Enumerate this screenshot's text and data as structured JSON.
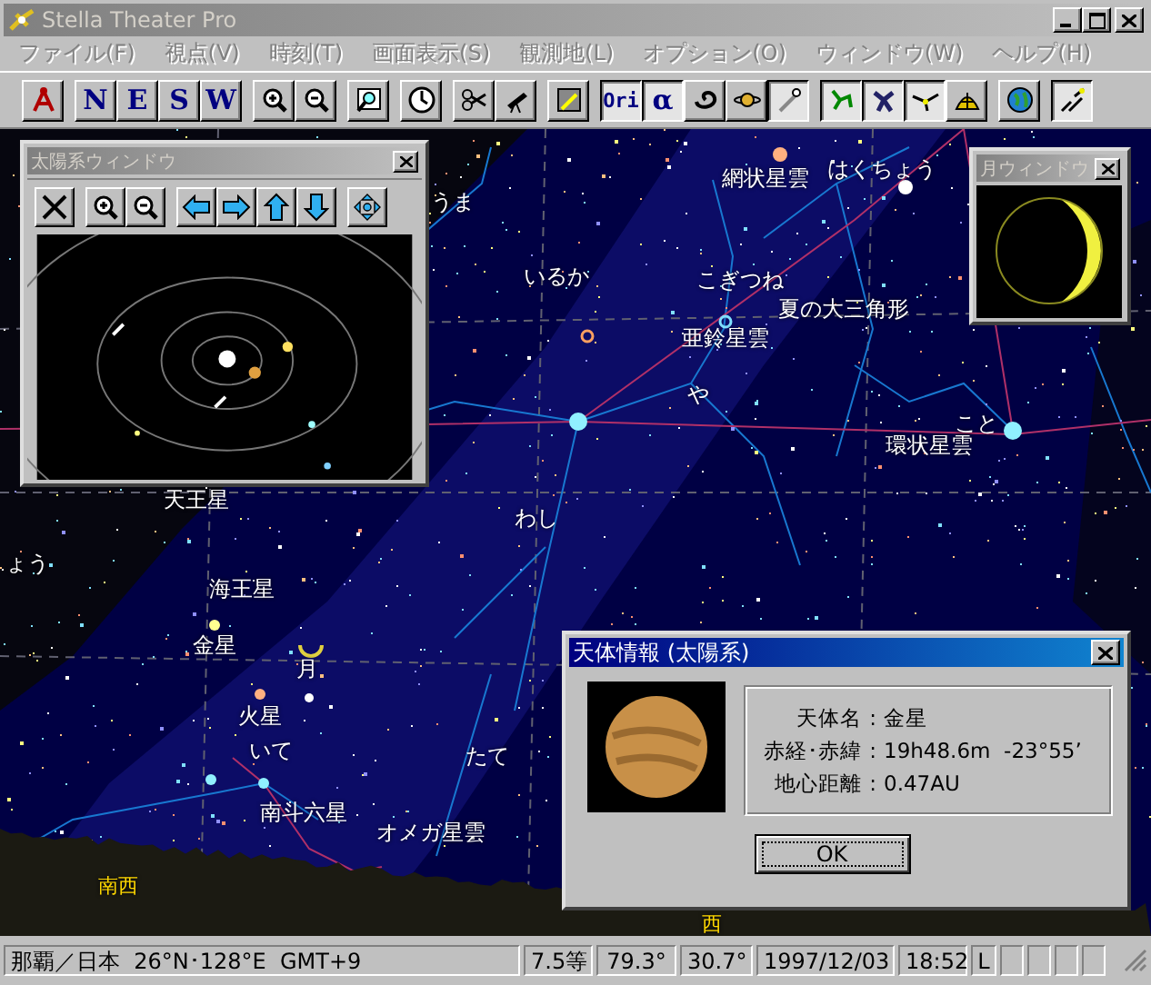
{
  "window": {
    "title": "Stella Theater Pro",
    "active": false
  },
  "menu": [
    {
      "label": "ファイル(F)",
      "disabled": true
    },
    {
      "label": "視点(V)",
      "disabled": true
    },
    {
      "label": "時刻(T)",
      "disabled": true
    },
    {
      "label": "画面表示(S)",
      "disabled": true
    },
    {
      "label": "観測地(L)",
      "disabled": true
    },
    {
      "label": "オプション(O)",
      "disabled": true
    },
    {
      "label": "ウィンドウ(W)",
      "disabled": true
    },
    {
      "label": "ヘルプ(H)",
      "disabled": true
    }
  ],
  "toolbar": [
    {
      "kind": "icon",
      "pressed": false
    },
    {
      "kind": "text",
      "label": "N",
      "pressed": false
    },
    {
      "kind": "text",
      "label": "E",
      "pressed": false
    },
    {
      "kind": "text",
      "label": "S",
      "pressed": false
    },
    {
      "kind": "text",
      "label": "W",
      "pressed": false
    },
    {
      "kind": "icon",
      "pressed": false
    },
    {
      "kind": "icon",
      "pressed": false
    },
    {
      "kind": "icon",
      "pressed": false
    },
    {
      "kind": "icon",
      "pressed": false
    },
    {
      "kind": "icon",
      "pressed": false
    },
    {
      "kind": "icon",
      "pressed": false
    },
    {
      "kind": "icon",
      "pressed": false
    },
    {
      "kind": "text",
      "label": "Ori",
      "pressed": true
    },
    {
      "kind": "text",
      "label": "α",
      "pressed": true
    },
    {
      "kind": "icon",
      "pressed": false
    },
    {
      "kind": "icon",
      "pressed": false
    },
    {
      "kind": "icon",
      "pressed": true
    },
    {
      "kind": "icon",
      "pressed": true
    },
    {
      "kind": "icon",
      "pressed": true
    },
    {
      "kind": "icon",
      "pressed": true
    },
    {
      "kind": "icon",
      "pressed": false
    },
    {
      "kind": "icon",
      "pressed": false
    },
    {
      "kind": "icon",
      "pressed": true
    }
  ],
  "sky_labels": [
    {
      "text": "うま",
      "kind": "name"
    },
    {
      "text": "網状星雲",
      "kind": "name"
    },
    {
      "text": "はくちょう",
      "kind": "name"
    },
    {
      "text": "いるか",
      "kind": "name"
    },
    {
      "text": "こぎつね",
      "kind": "name"
    },
    {
      "text": "夏の大三角形",
      "kind": "name"
    },
    {
      "text": "亜鈴星雲",
      "kind": "name"
    },
    {
      "text": "や",
      "kind": "name"
    },
    {
      "text": "こと",
      "kind": "name"
    },
    {
      "text": "環状星雲",
      "kind": "name"
    },
    {
      "text": "わし",
      "kind": "name"
    },
    {
      "text": "天王星",
      "kind": "name"
    },
    {
      "text": "ょう",
      "kind": "name"
    },
    {
      "text": "海王星",
      "kind": "name"
    },
    {
      "text": "金星",
      "kind": "name"
    },
    {
      "text": "月",
      "kind": "name"
    },
    {
      "text": "火星",
      "kind": "name"
    },
    {
      "text": "いて",
      "kind": "name"
    },
    {
      "text": "たて",
      "kind": "name"
    },
    {
      "text": "南斗六星",
      "kind": "name"
    },
    {
      "text": "オメガ星雲",
      "kind": "name"
    },
    {
      "text": "南西",
      "kind": "direction"
    },
    {
      "text": "西",
      "kind": "direction"
    }
  ],
  "solar_window": {
    "title": "太陽系ウィンドウ",
    "active": false
  },
  "moon_window": {
    "title": "月ウィンドウ",
    "active": false
  },
  "info_dialog": {
    "title": "天体情報 (太陽系)",
    "active": true,
    "rows": [
      {
        "label": "天体名",
        "separator": ":",
        "value": "金星"
      },
      {
        "label": "赤経･赤緯",
        "separator": ":",
        "value": "19h48.6m  -23°55’"
      },
      {
        "label": "地心距離",
        "separator": ":",
        "value": "0.47AU"
      }
    ],
    "ok_button": "OK"
  },
  "status_bar": {
    "location": "那覇／日本  26°N･128°E  GMT+9",
    "magnitude": "7.5等",
    "value_1": "79.3°",
    "value_2": "30.7°",
    "date": "1997/12/03",
    "time": "18:52",
    "mode": "L"
  }
}
